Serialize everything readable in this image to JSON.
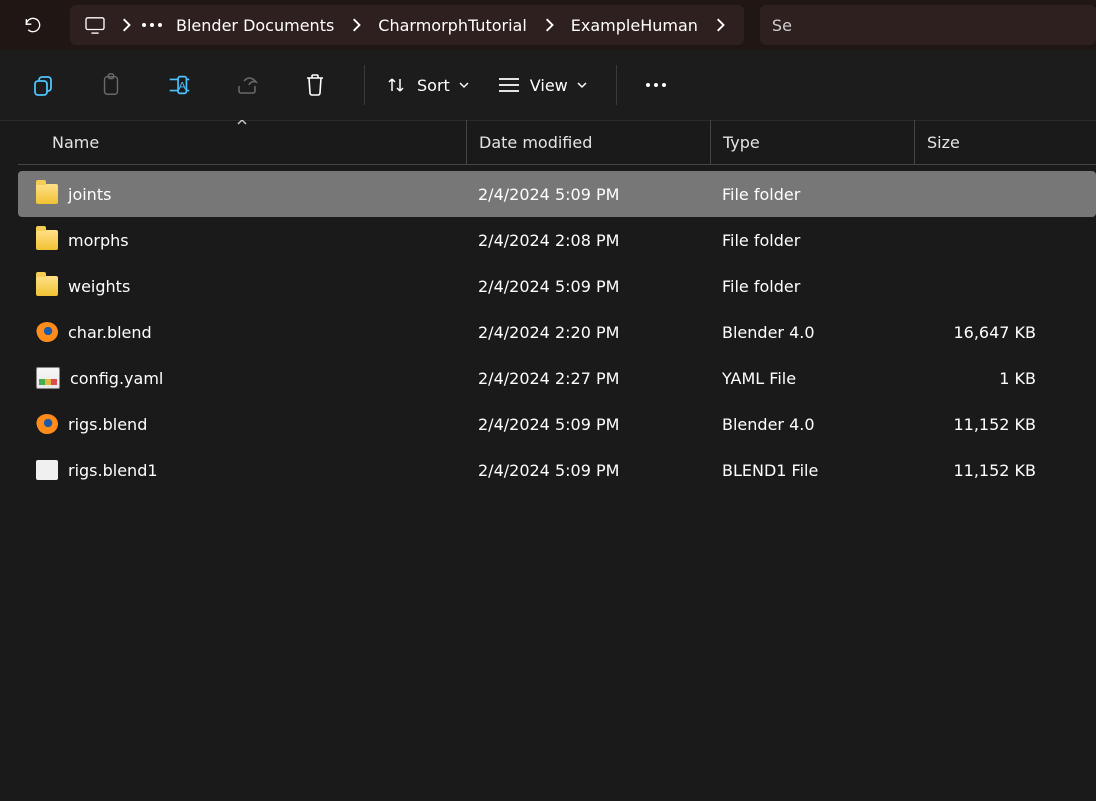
{
  "breadcrumb": {
    "items": [
      "Blender Documents",
      "CharmorphTutorial",
      "ExampleHuman"
    ]
  },
  "search": {
    "hint": "Se"
  },
  "toolbar": {
    "sort_label": "Sort",
    "view_label": "View"
  },
  "columns": {
    "name": "Name",
    "date": "Date modified",
    "type": "Type",
    "size": "Size",
    "sorted_by": "name",
    "sort_dir": "asc"
  },
  "files": [
    {
      "name": "joints",
      "date": "2/4/2024 5:09 PM",
      "type": "File folder",
      "size": "",
      "icon": "folder",
      "selected": true
    },
    {
      "name": "morphs",
      "date": "2/4/2024 2:08 PM",
      "type": "File folder",
      "size": "",
      "icon": "folder",
      "selected": false
    },
    {
      "name": "weights",
      "date": "2/4/2024 5:09 PM",
      "type": "File folder",
      "size": "",
      "icon": "folder",
      "selected": false
    },
    {
      "name": "char.blend",
      "date": "2/4/2024 2:20 PM",
      "type": "Blender 4.0",
      "size": "16,647 KB",
      "icon": "blender",
      "selected": false
    },
    {
      "name": "config.yaml",
      "date": "2/4/2024 2:27 PM",
      "type": "YAML File",
      "size": "1 KB",
      "icon": "yaml",
      "selected": false
    },
    {
      "name": "rigs.blend",
      "date": "2/4/2024 5:09 PM",
      "type": "Blender 4.0",
      "size": "11,152 KB",
      "icon": "blender",
      "selected": false
    },
    {
      "name": "rigs.blend1",
      "date": "2/4/2024 5:09 PM",
      "type": "BLEND1 File",
      "size": "11,152 KB",
      "icon": "blank",
      "selected": false
    }
  ]
}
